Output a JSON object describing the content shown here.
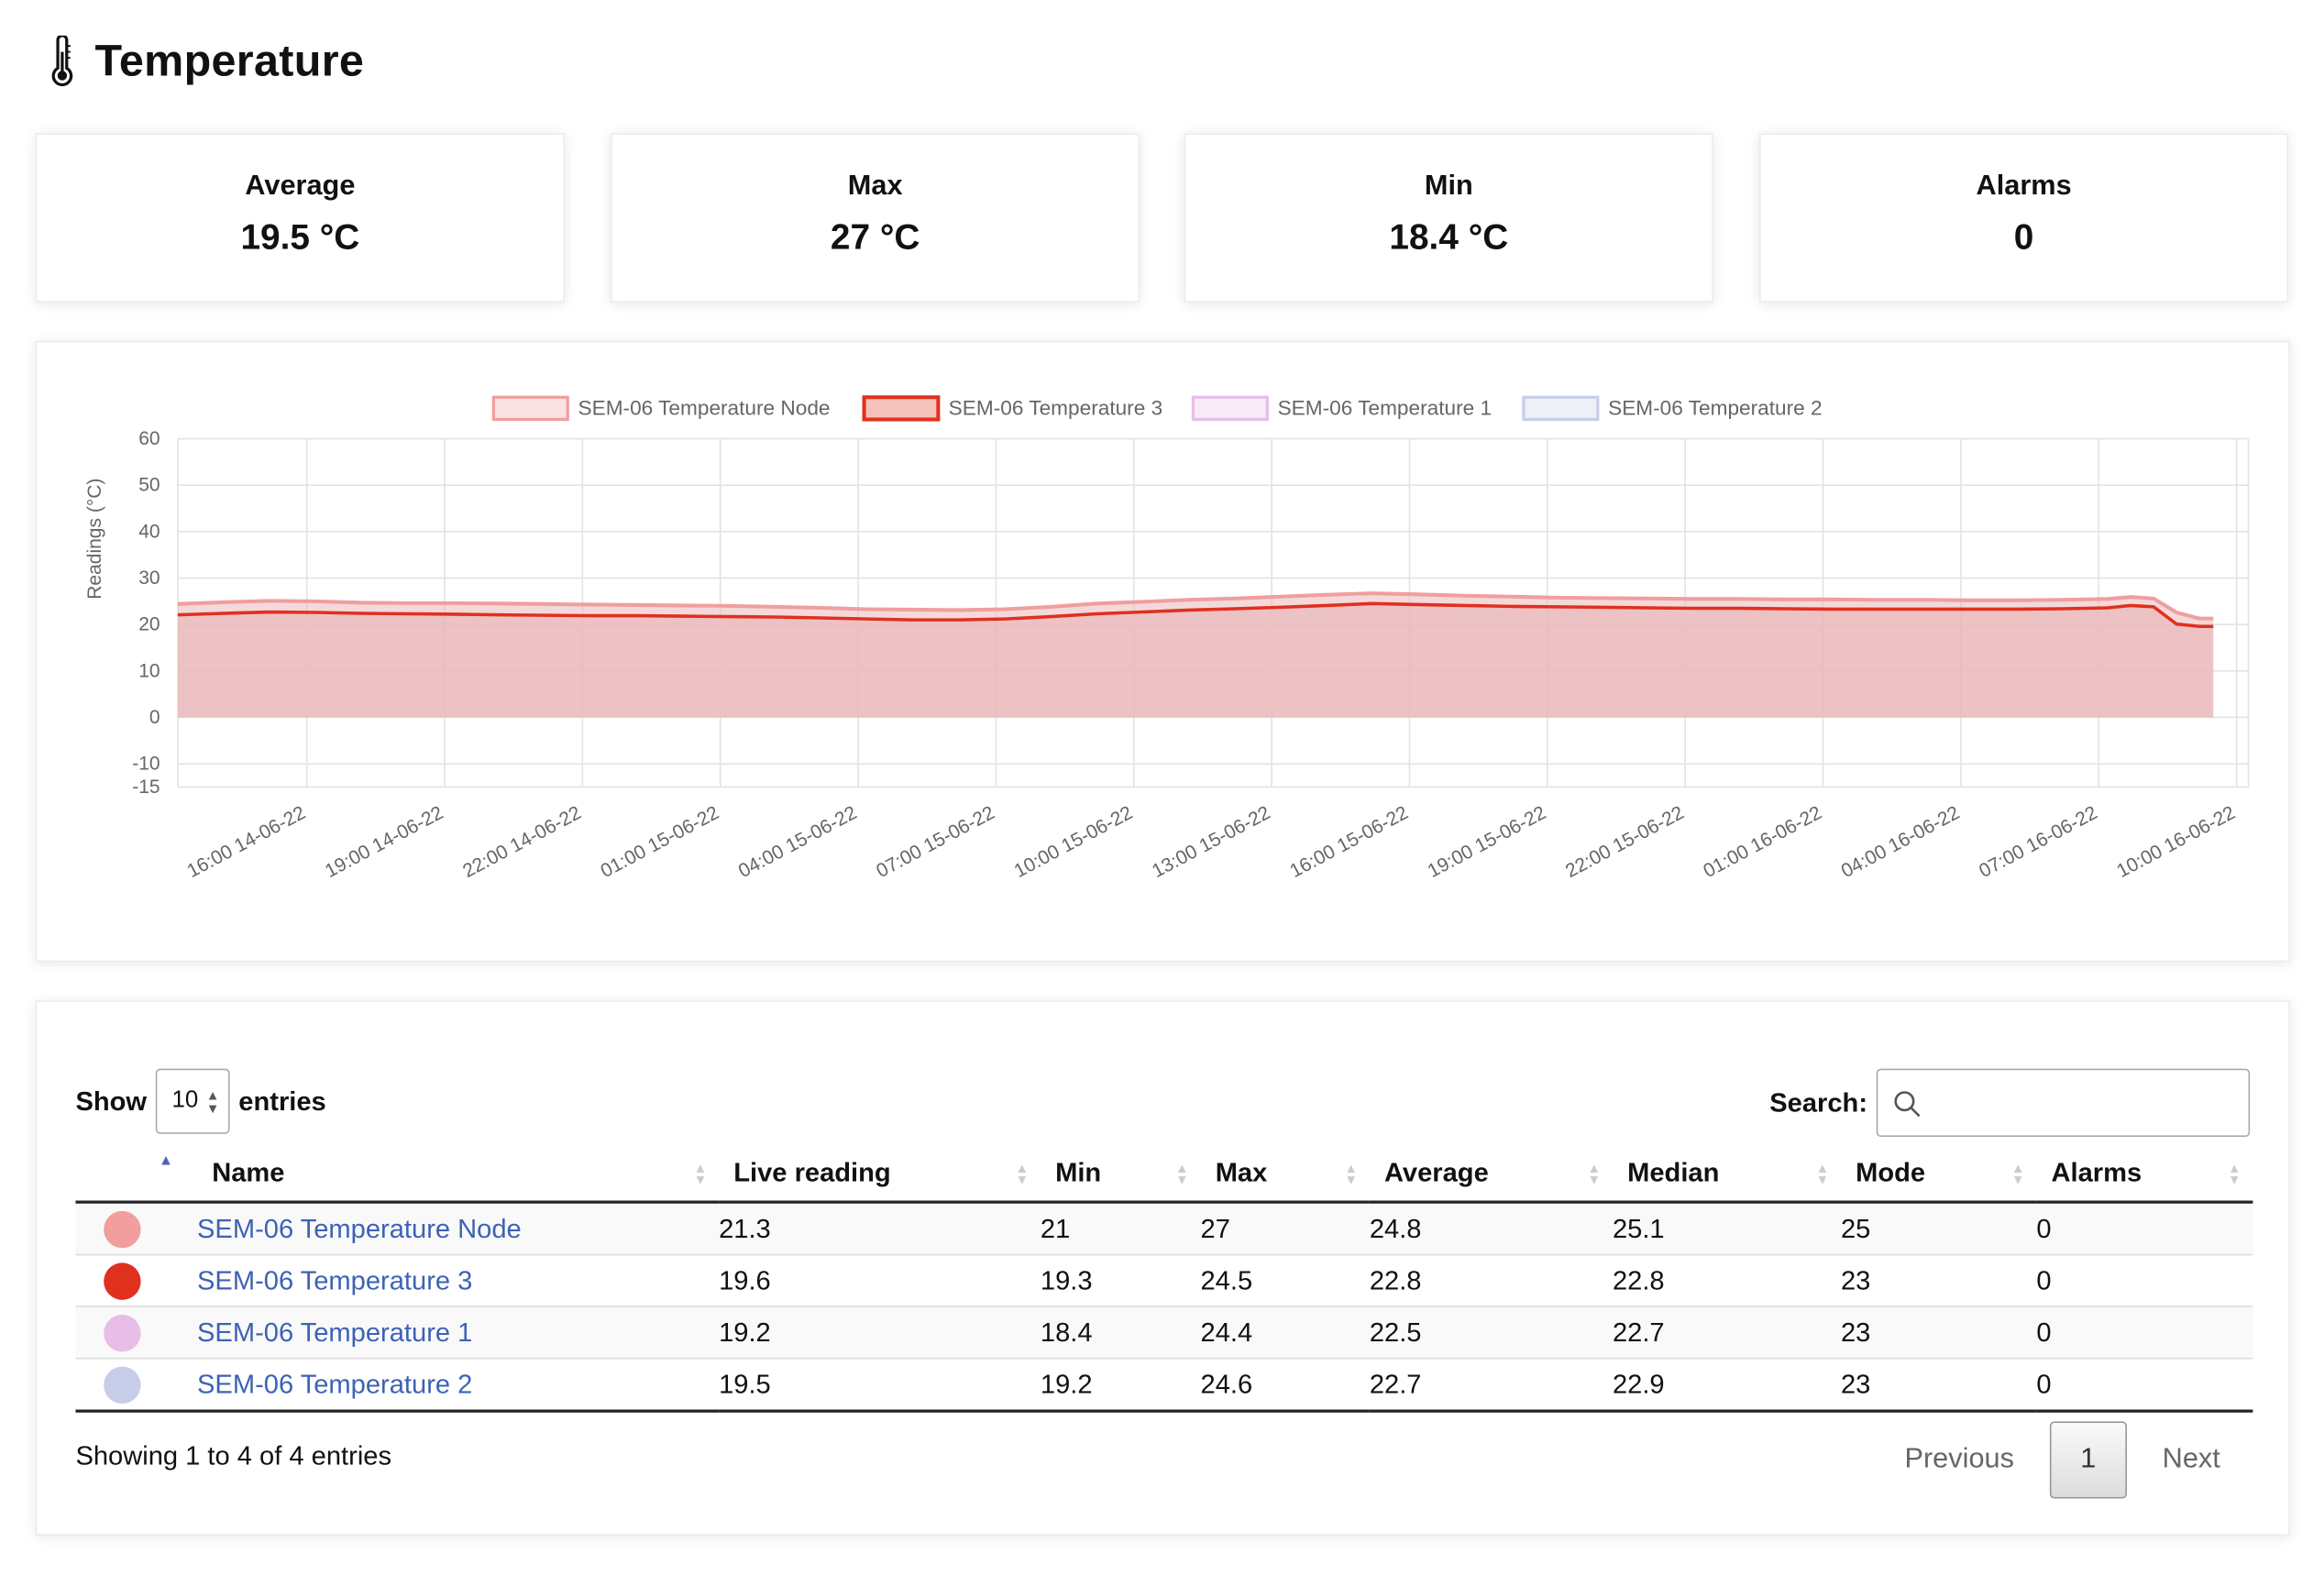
{
  "page": {
    "title": "Temperature"
  },
  "stats": [
    {
      "label": "Average",
      "value": "19.5 °C"
    },
    {
      "label": "Max",
      "value": "27 °C"
    },
    {
      "label": "Min",
      "value": "18.4 °C"
    },
    {
      "label": "Alarms",
      "value": "0"
    }
  ],
  "colors": {
    "node": "#f09e9e",
    "t3": "#e0301e",
    "t1": "#e8bde8",
    "t2": "#c7cde9",
    "fill": "#ebb9bc",
    "link": "#3d62b5"
  },
  "chart_data": {
    "type": "area",
    "ylabel": "Readings (°C)",
    "ylim": [
      -15,
      60
    ],
    "yticks": [
      "60",
      "50",
      "40",
      "30",
      "20",
      "10",
      "0",
      "-10",
      "-15"
    ],
    "ytick_values": [
      60,
      50,
      40,
      30,
      20,
      10,
      0,
      -10,
      -15
    ],
    "xtick_labels": [
      "16:00 14-06-22",
      "19:00 14-06-22",
      "22:00 14-06-22",
      "01:00 15-06-22",
      "04:00 15-06-22",
      "07:00 15-06-22",
      "10:00 15-06-22",
      "13:00 15-06-22",
      "16:00 15-06-22",
      "19:00 15-06-22",
      "22:00 15-06-22",
      "01:00 16-06-22",
      "04:00 16-06-22",
      "07:00 16-06-22",
      "10:00 16-06-22"
    ],
    "x_hours": [
      0,
      1,
      2,
      3,
      4,
      5,
      6,
      7,
      8,
      9,
      10,
      11,
      12,
      13,
      14,
      15,
      16,
      17,
      18,
      19,
      20,
      21,
      22,
      23,
      24,
      25,
      26,
      27,
      28,
      29,
      30,
      31,
      32,
      33,
      34,
      35,
      36,
      37,
      38,
      39,
      40,
      41,
      42,
      42.5,
      43,
      43.5,
      44,
      44.3
    ],
    "series": [
      {
        "name": "SEM-06 Temperature Node",
        "color": "#f09e9e",
        "values": [
          24.4,
          24.8,
          25.1,
          25.0,
          24.7,
          24.6,
          24.6,
          24.5,
          24.4,
          24.3,
          24.2,
          24.1,
          24.0,
          23.8,
          23.6,
          23.3,
          23.2,
          23.1,
          23.3,
          23.8,
          24.5,
          24.9,
          25.3,
          25.6,
          26.0,
          26.4,
          26.7,
          26.5,
          26.2,
          26.0,
          25.8,
          25.7,
          25.6,
          25.5,
          25.5,
          25.4,
          25.4,
          25.3,
          25.3,
          25.2,
          25.2,
          25.3,
          25.5,
          25.9,
          25.6,
          22.6,
          21.3,
          21.3
        ]
      },
      {
        "name": "SEM-06 Temperature 3",
        "color": "#e0301e",
        "values": [
          22.1,
          22.4,
          22.7,
          22.6,
          22.4,
          22.3,
          22.2,
          22.1,
          22.0,
          21.9,
          21.9,
          21.8,
          21.7,
          21.6,
          21.4,
          21.2,
          21.0,
          21.0,
          21.2,
          21.7,
          22.3,
          22.7,
          23.1,
          23.4,
          23.7,
          24.1,
          24.5,
          24.3,
          24.1,
          23.9,
          23.8,
          23.7,
          23.6,
          23.5,
          23.5,
          23.4,
          23.3,
          23.3,
          23.3,
          23.3,
          23.3,
          23.4,
          23.6,
          24.1,
          23.8,
          20.1,
          19.6,
          19.6
        ]
      },
      {
        "name": "SEM-06 Temperature 1",
        "color": "#e8bde8",
        "values": []
      },
      {
        "name": "SEM-06 Temperature 2",
        "color": "#c7cde9",
        "values": []
      }
    ]
  },
  "table": {
    "show_label": "Show",
    "length_value": "10",
    "entries_label": "entries",
    "search_label": "Search:",
    "search_value": "",
    "columns": [
      "",
      "Name",
      "Live reading",
      "Min",
      "Max",
      "Average",
      "Median",
      "Mode",
      "Alarms"
    ],
    "rows": [
      {
        "color": "#f09e9e",
        "name": "SEM-06 Temperature Node",
        "live": "21.3",
        "min": "21",
        "max": "27",
        "avg": "24.8",
        "median": "25.1",
        "mode": "25",
        "alarms": "0"
      },
      {
        "color": "#e0301e",
        "name": "SEM-06 Temperature 3",
        "live": "19.6",
        "min": "19.3",
        "max": "24.5",
        "avg": "22.8",
        "median": "22.8",
        "mode": "23",
        "alarms": "0"
      },
      {
        "color": "#e8bde8",
        "name": "SEM-06 Temperature 1",
        "live": "19.2",
        "min": "18.4",
        "max": "24.4",
        "avg": "22.5",
        "median": "22.7",
        "mode": "23",
        "alarms": "0"
      },
      {
        "color": "#c7cde9",
        "name": "SEM-06 Temperature 2",
        "live": "19.5",
        "min": "19.2",
        "max": "24.6",
        "avg": "22.7",
        "median": "22.9",
        "mode": "23",
        "alarms": "0"
      }
    ],
    "info": "Showing 1 to 4 of 4 entries",
    "pagination": {
      "previous": "Previous",
      "page": "1",
      "next": "Next"
    }
  }
}
